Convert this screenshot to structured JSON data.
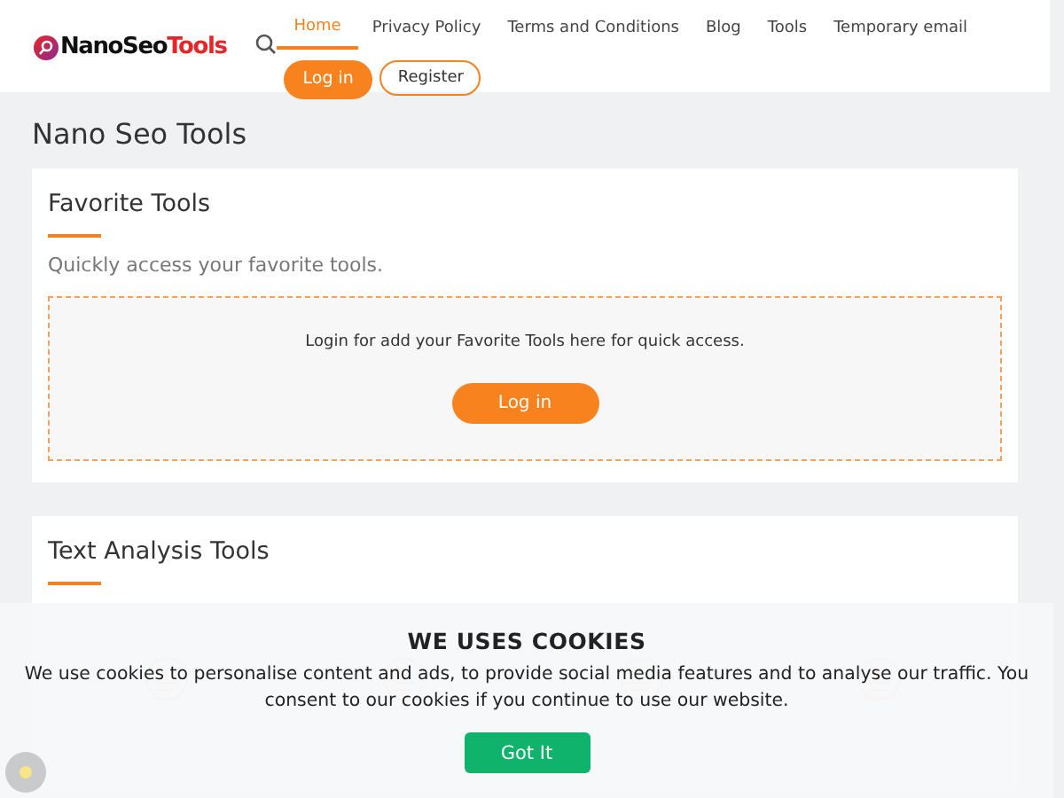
{
  "header": {
    "logo": {
      "prefix": "NanoSeo",
      "suffix": "Tools"
    },
    "nav": [
      {
        "label": "Home",
        "selected": true,
        "kind": "link"
      },
      {
        "label": "Privacy Policy",
        "selected": false,
        "kind": "link"
      },
      {
        "label": "Terms and Conditions",
        "selected": false,
        "kind": "link"
      },
      {
        "label": "Blog",
        "selected": false,
        "kind": "link"
      },
      {
        "label": "Tools",
        "selected": false,
        "kind": "link"
      },
      {
        "label": "Temporary email",
        "selected": false,
        "kind": "link"
      },
      {
        "label": "Log in",
        "kind": "primary"
      },
      {
        "label": "Register",
        "kind": "outline"
      }
    ]
  },
  "page_title": "Nano Seo Tools",
  "favorites": {
    "title": "Favorite Tools",
    "subtitle": "Quickly access your favorite tools.",
    "message": "Login for add your Favorite Tools here for quick access.",
    "button": "Log in"
  },
  "text_analysis": {
    "title": "Text Analysis Tools",
    "tools": [
      {
        "kind": "tile"
      },
      {
        "kind": "tile"
      },
      {
        "kind": "tile"
      },
      {
        "kind": "tile"
      }
    ]
  },
  "cookie_banner": {
    "title": "WE USES COOKIES",
    "message": "We use cookies to personalise content and ads, to provide social media features and to analyse our traffic. You consent to our cookies if you continue to use our website.",
    "button": "Got It"
  }
}
